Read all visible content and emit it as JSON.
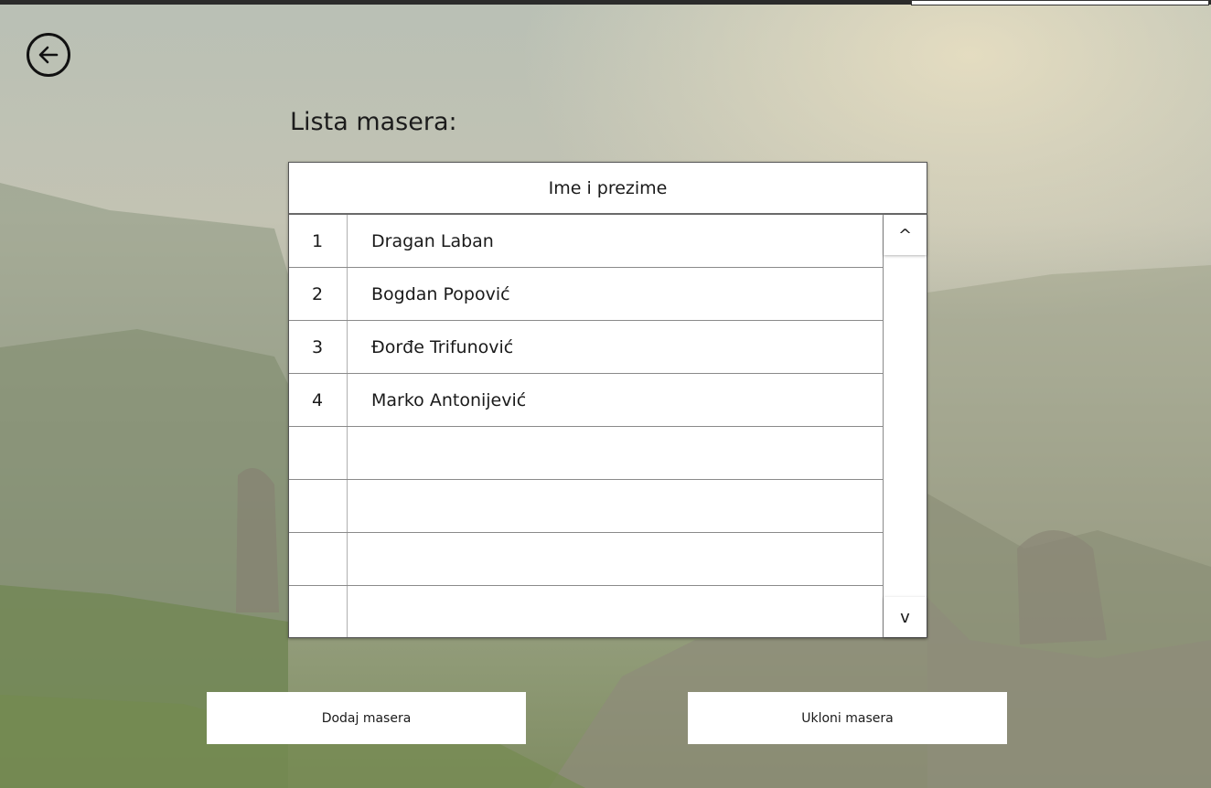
{
  "page": {
    "title": "Lista masera:"
  },
  "table": {
    "header": "Ime i prezime",
    "rows": [
      {
        "num": "1",
        "name": "Dragan Laban"
      },
      {
        "num": "2",
        "name": "Bogdan Popović"
      },
      {
        "num": "3",
        "name": "Đorđe Trifunović"
      },
      {
        "num": "4",
        "name": "Marko Antonijević"
      },
      {
        "num": "",
        "name": ""
      },
      {
        "num": "",
        "name": ""
      },
      {
        "num": "",
        "name": ""
      },
      {
        "num": "",
        "name": ""
      }
    ],
    "scroll_up": "^",
    "scroll_down": "v"
  },
  "actions": {
    "add_label": "Dodaj masera",
    "remove_label": "Ukloni masera"
  },
  "icons": {
    "back": "arrow-left-circle-icon"
  }
}
